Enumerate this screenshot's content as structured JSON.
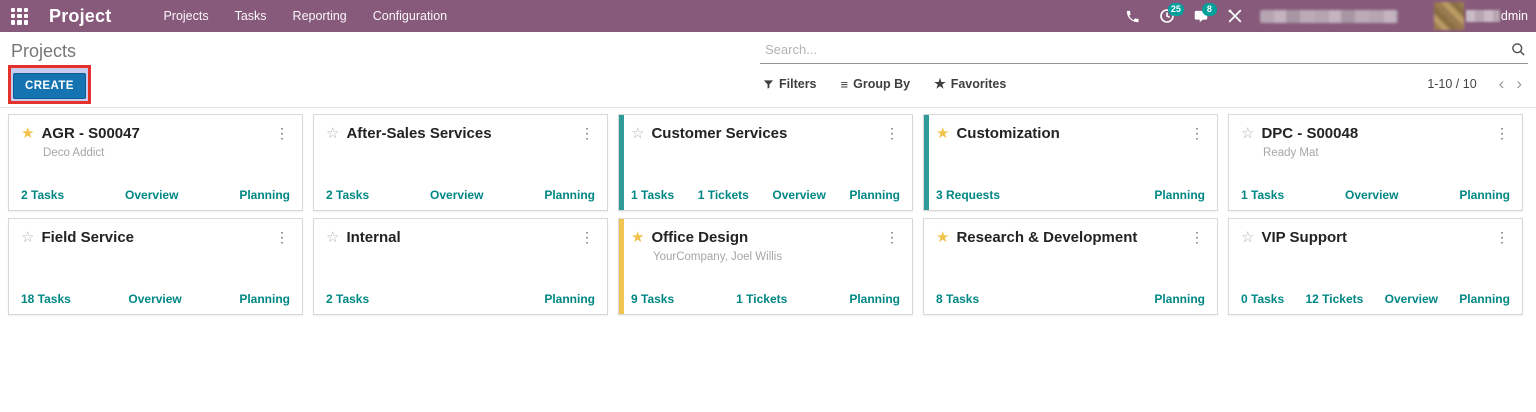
{
  "topbar": {
    "app_title": "Project",
    "menu": [
      "Projects",
      "Tasks",
      "Reporting",
      "Configuration"
    ],
    "activity_badge": "25",
    "message_badge": "8",
    "user_suffix": "dmin"
  },
  "control_panel": {
    "breadcrumb": "Projects",
    "create_label": "CREATE",
    "search_placeholder": "Search...",
    "filters_label": "Filters",
    "group_by_label": "Group By",
    "favorites_label": "Favorites",
    "pager_count": "1-10 / 10"
  },
  "colors": {
    "brand_purple": "#875A7B",
    "badge_teal": "#00A09D",
    "link_teal": "#008784",
    "star_gold": "#F0C24B",
    "strip_teal": "#2E9B99",
    "strip_yellow": "#EFC451",
    "create_blue": "#1673B1",
    "annotation_red": "#E5312B"
  },
  "cards": [
    {
      "title": "AGR - S00047",
      "starred": true,
      "subtitle": "Deco Addict",
      "strip": "none",
      "links": [
        "2 Tasks",
        "Overview",
        "Planning"
      ]
    },
    {
      "title": "After-Sales Services",
      "starred": false,
      "subtitle": "",
      "strip": "none",
      "links": [
        "2 Tasks",
        "Overview",
        "Planning"
      ]
    },
    {
      "title": "Customer Services",
      "starred": false,
      "subtitle": "",
      "strip": "teal",
      "links": [
        "1 Tasks",
        "1 Tickets",
        "Overview",
        "Planning"
      ]
    },
    {
      "title": "Customization",
      "starred": true,
      "subtitle": "",
      "strip": "teal",
      "links": [
        "3 Requests",
        "Planning"
      ]
    },
    {
      "title": "DPC - S00048",
      "starred": false,
      "subtitle": "Ready Mat",
      "strip": "none",
      "links": [
        "1 Tasks",
        "Overview",
        "Planning"
      ]
    },
    {
      "title": "Field Service",
      "starred": false,
      "subtitle": "",
      "strip": "none",
      "links": [
        "18 Tasks",
        "Overview",
        "Planning"
      ]
    },
    {
      "title": "Internal",
      "starred": false,
      "subtitle": "",
      "strip": "none",
      "links": [
        "2 Tasks",
        "Planning"
      ]
    },
    {
      "title": "Office Design",
      "starred": true,
      "subtitle": "YourCompany, Joel Willis",
      "strip": "yellow",
      "links": [
        "9 Tasks",
        "1 Tickets",
        "Planning"
      ]
    },
    {
      "title": "Research & Development",
      "starred": true,
      "subtitle": "",
      "strip": "none",
      "links": [
        "8 Tasks",
        "Planning"
      ]
    },
    {
      "title": "VIP Support",
      "starred": false,
      "subtitle": "",
      "strip": "none",
      "links": [
        "0 Tasks",
        "12 Tickets",
        "Overview",
        "Planning"
      ]
    }
  ]
}
